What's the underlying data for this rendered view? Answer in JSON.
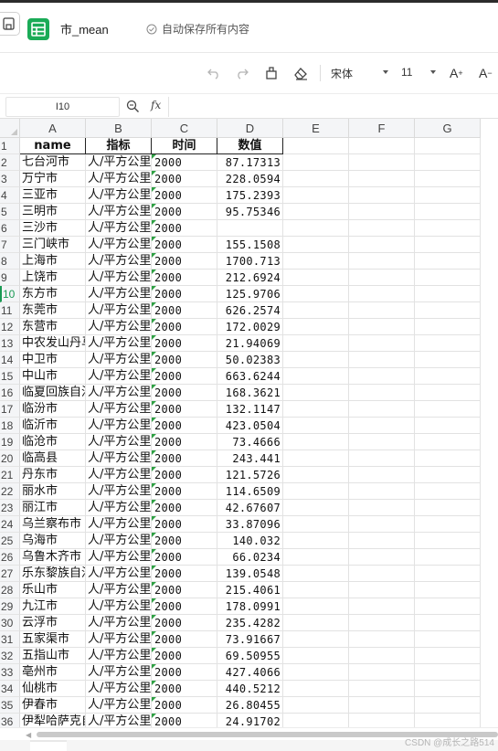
{
  "app": {
    "file_name": "市_mean",
    "save_status": "自动保存所有内容",
    "watermark": "CSDN @成长之路514"
  },
  "toolbar": {
    "font_name": "宋体",
    "font_size": "11",
    "icons": [
      "undo-icon",
      "redo-icon",
      "format-painter-icon",
      "eraser-icon",
      "increase-font-icon",
      "decrease-font-icon"
    ]
  },
  "formula_bar": {
    "cell_ref": "I10",
    "fx_label": "fx",
    "value": ""
  },
  "sheet": {
    "active_row": 10,
    "columns": [
      "A",
      "B",
      "C",
      "D",
      "E",
      "F",
      "G"
    ],
    "header": [
      "name",
      "指标",
      "时间",
      "数值"
    ],
    "rows": [
      [
        "七台河市",
        "人/平方公里",
        "2000",
        "87.17313"
      ],
      [
        "万宁市",
        "人/平方公里",
        "2000",
        "228.0594"
      ],
      [
        "三亚市",
        "人/平方公里",
        "2000",
        "175.2393"
      ],
      [
        "三明市",
        "人/平方公里",
        "2000",
        "95.75346"
      ],
      [
        "三沙市",
        "人/平方公里",
        "2000",
        ""
      ],
      [
        "三门峡市",
        "人/平方公里",
        "2000",
        "155.1508"
      ],
      [
        "上海市",
        "人/平方公里",
        "2000",
        "1700.713"
      ],
      [
        "上饶市",
        "人/平方公里",
        "2000",
        "212.6924"
      ],
      [
        "东方市",
        "人/平方公里",
        "2000",
        "125.9706"
      ],
      [
        "东莞市",
        "人/平方公里",
        "2000",
        "626.2574"
      ],
      [
        "东营市",
        "人/平方公里",
        "2000",
        "172.0029"
      ],
      [
        "中农发山丹马场",
        "人/平方公里",
        "2000",
        "21.94069"
      ],
      [
        "中卫市",
        "人/平方公里",
        "2000",
        "50.02383"
      ],
      [
        "中山市",
        "人/平方公里",
        "2000",
        "663.6244"
      ],
      [
        "临夏回族自治州",
        "人/平方公里",
        "2000",
        "168.3621"
      ],
      [
        "临汾市",
        "人/平方公里",
        "2000",
        "132.1147"
      ],
      [
        "临沂市",
        "人/平方公里",
        "2000",
        "423.0504"
      ],
      [
        "临沧市",
        "人/平方公里",
        "2000",
        "73.4666"
      ],
      [
        "临高县",
        "人/平方公里",
        "2000",
        "243.441"
      ],
      [
        "丹东市",
        "人/平方公里",
        "2000",
        "121.5726"
      ],
      [
        "丽水市",
        "人/平方公里",
        "2000",
        "114.6509"
      ],
      [
        "丽江市",
        "人/平方公里",
        "2000",
        "42.67607"
      ],
      [
        "乌兰察布市",
        "人/平方公里",
        "2000",
        "33.87096"
      ],
      [
        "乌海市",
        "人/平方公里",
        "2000",
        "140.032"
      ],
      [
        "乌鲁木齐市",
        "人/平方公里",
        "2000",
        "66.0234"
      ],
      [
        "乐东黎族自治县",
        "人/平方公里",
        "2000",
        "139.0548"
      ],
      [
        "乐山市",
        "人/平方公里",
        "2000",
        "215.4061"
      ],
      [
        "九江市",
        "人/平方公里",
        "2000",
        "178.0991"
      ],
      [
        "云浮市",
        "人/平方公里",
        "2000",
        "235.4282"
      ],
      [
        "五家渠市",
        "人/平方公里",
        "2000",
        "73.91667"
      ],
      [
        "五指山市",
        "人/平方公里",
        "2000",
        "69.50955"
      ],
      [
        "亳州市",
        "人/平方公里",
        "2000",
        "427.4066"
      ],
      [
        "仙桃市",
        "人/平方公里",
        "2000",
        "440.5212"
      ],
      [
        "伊春市",
        "人/平方公里",
        "2000",
        "26.80455"
      ],
      [
        "伊犁哈萨克自治州",
        "人/平方公里",
        "2000",
        "24.91702"
      ]
    ]
  }
}
